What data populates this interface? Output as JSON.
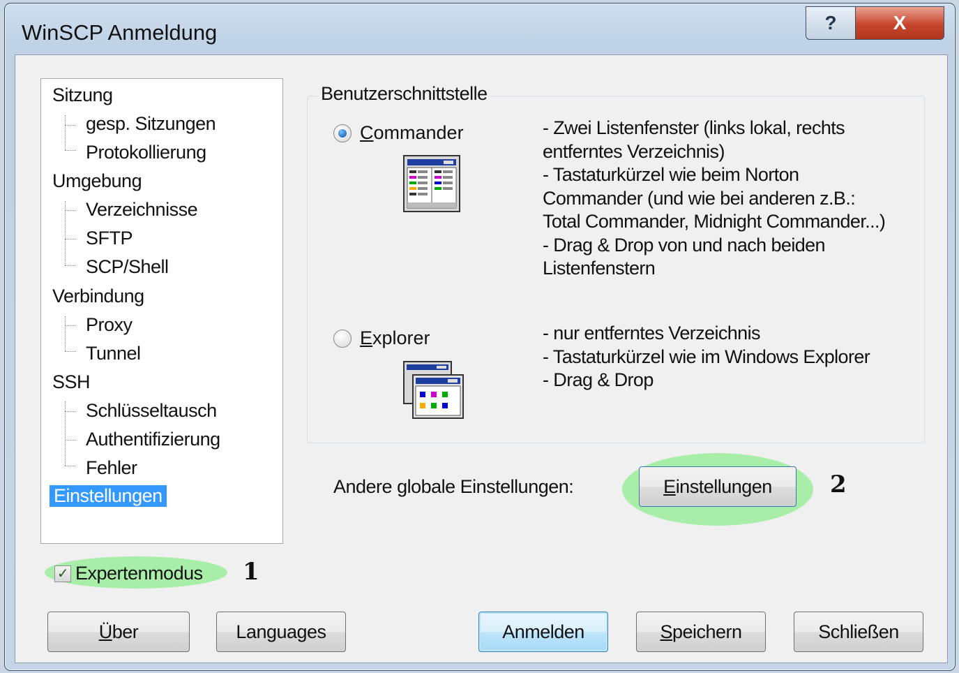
{
  "window": {
    "title": "WinSCP Anmeldung"
  },
  "titlebar": {
    "help_label": "?",
    "close_label": "X"
  },
  "tree": {
    "items": [
      {
        "label": "Sitzung",
        "level": 0
      },
      {
        "label": "gesp. Sitzungen",
        "level": 1
      },
      {
        "label": "Protokollierung",
        "level": 1
      },
      {
        "label": "Umgebung",
        "level": 0
      },
      {
        "label": "Verzeichnisse",
        "level": 1
      },
      {
        "label": "SFTP",
        "level": 1
      },
      {
        "label": "SCP/Shell",
        "level": 1
      },
      {
        "label": "Verbindung",
        "level": 0
      },
      {
        "label": "Proxy",
        "level": 1
      },
      {
        "label": "Tunnel",
        "level": 1
      },
      {
        "label": "SSH",
        "level": 0
      },
      {
        "label": "Schlüsseltausch",
        "level": 1
      },
      {
        "label": "Authentifizierung",
        "level": 1
      },
      {
        "label": "Fehler",
        "level": 1
      },
      {
        "label": "Einstellungen",
        "level": 0,
        "selected": true
      }
    ]
  },
  "interface_group": {
    "title": "Benutzerschnittstelle",
    "commander": {
      "label_first": "C",
      "label_rest": "ommander",
      "selected": true,
      "description": "- Zwei Listenfenster (links lokal, rechts\nentferntes Verzeichnis)\n- Tastaturkürzel wie beim Norton\nCommander (und wie bei anderen z.B.:\nTotal Commander, Midnight Commander...)\n- Drag & Drop von und nach beiden\nListenfenstern"
    },
    "explorer": {
      "label_first": "E",
      "label_rest": "xplorer",
      "selected": false,
      "description": "- nur entferntes Verzeichnis\n- Tastaturkürzel wie im Windows Explorer\n- Drag & Drop"
    }
  },
  "global_settings": {
    "label": "Andere globale Einstellungen:",
    "button_first": "E",
    "button_rest": "instellungen"
  },
  "expert_mode": {
    "label": "Expertenmodus",
    "checked": true,
    "check_glyph": "✓"
  },
  "annotations": {
    "one": "1",
    "two": "2"
  },
  "buttons": {
    "about": {
      "first": "Ü",
      "rest": "ber"
    },
    "languages": "Languages",
    "login": "Anmelden",
    "save": {
      "first": "S",
      "rest": "peichern"
    },
    "close": "Schließen"
  },
  "colors": {
    "selection": "#3399ff",
    "highlight": "#90ee90",
    "close_button": "#c8452d"
  }
}
